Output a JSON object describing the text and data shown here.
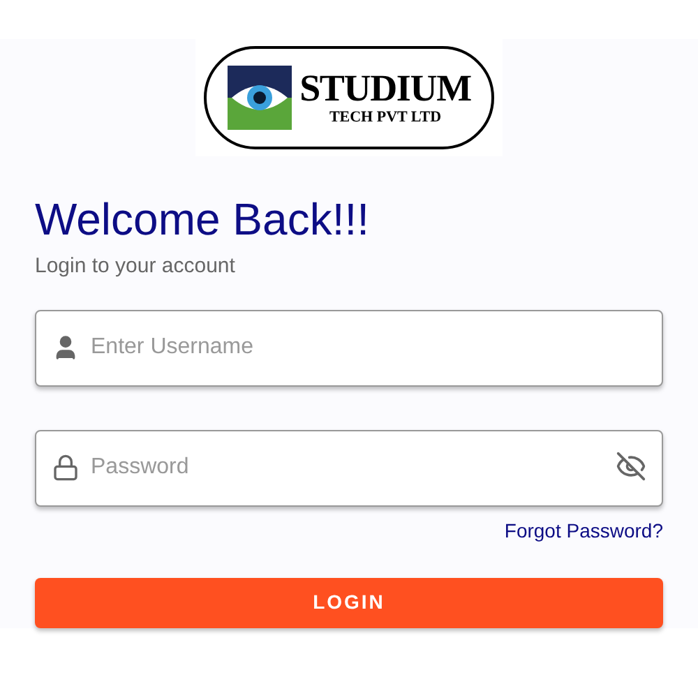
{
  "logo": {
    "name": "STUDIUM",
    "tagline": "TECH PVT LTD"
  },
  "title": "Welcome Back!!!",
  "subtitle": "Login to your account",
  "username": {
    "placeholder": "Enter Username"
  },
  "password": {
    "placeholder": "Password",
    "visible": false
  },
  "forgot_link": "Forgot Password?",
  "login_button": "LOGIN"
}
